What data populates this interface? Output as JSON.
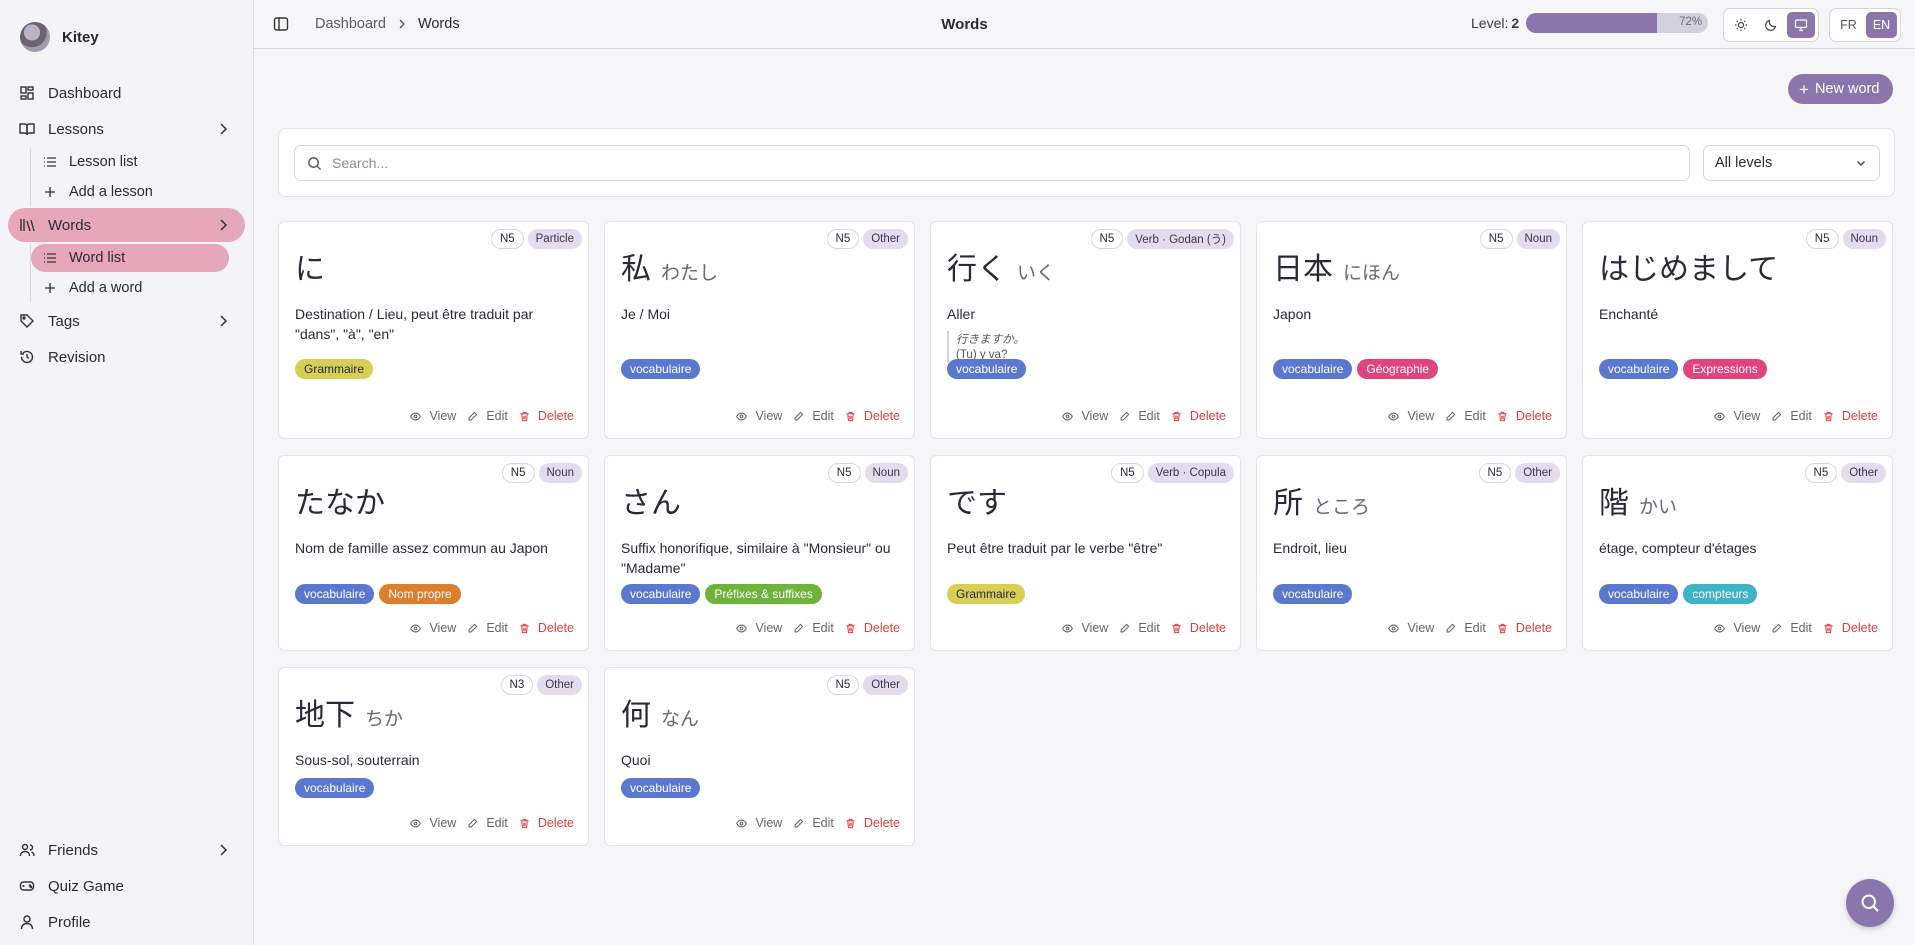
{
  "user": {
    "name": "Kitey"
  },
  "sidebar": {
    "dashboard": "Dashboard",
    "lessons": "Lessons",
    "lesson_list": "Lesson list",
    "add_lesson": "Add a lesson",
    "words": "Words",
    "word_list": "Word list",
    "add_word": "Add a word",
    "tags": "Tags",
    "revision": "Revision",
    "friends": "Friends",
    "quiz_game": "Quiz Game",
    "profile": "Profile"
  },
  "header": {
    "breadcrumb_root": "Dashboard",
    "breadcrumb_current": "Words",
    "title": "Words",
    "level_label": "Level:",
    "level_value": "2",
    "progress_text": "72%",
    "progress_value": 72,
    "lang_fr": "FR",
    "lang_en": "EN"
  },
  "toolbar": {
    "new_word": "New word",
    "search_placeholder": "Search...",
    "level_filter": "All levels"
  },
  "actions": {
    "view": "View",
    "edit": "Edit",
    "delete": "Delete"
  },
  "colors": {
    "accent": "#8a76ad",
    "active_nav": "#e5a7b9",
    "tag_vocabulaire": "#5b78cf",
    "tag_grammaire": "#d7cf55",
    "tag_geographie": "#e0447e",
    "tag_expressions": "#e0447e",
    "tag_nom_propre": "#dc7e2c",
    "tag_prefixes": "#6fb33a",
    "tag_compteurs": "#3fb3c6",
    "delete": "#e23c3c"
  },
  "cards": [
    {
      "kanji": "に",
      "reading": "",
      "level": "N5",
      "type": "Particle",
      "meaning": "Destination / Lieu, peut être traduit par \"dans\", \"à\", \"en\"",
      "example_jp": "",
      "example_fr": "",
      "tags": [
        {
          "label": "Grammaire",
          "color": "#d7cf55",
          "text": "#2a2a35"
        }
      ]
    },
    {
      "kanji": "私",
      "reading": "わたし",
      "level": "N5",
      "type": "Other",
      "meaning": "Je / Moi",
      "example_jp": "",
      "example_fr": "",
      "tags": [
        {
          "label": "vocabulaire",
          "color": "#5b78cf",
          "text": "#ffffff"
        }
      ]
    },
    {
      "kanji": "行く",
      "reading": "いく",
      "level": "N5",
      "type": "Verb · Godan (う)",
      "meaning": "Aller",
      "example_jp": "行きますか。",
      "example_fr": "(Tu) y va?",
      "tags": [
        {
          "label": "vocabulaire",
          "color": "#5b78cf",
          "text": "#ffffff"
        }
      ]
    },
    {
      "kanji": "日本",
      "reading": "にほん",
      "level": "N5",
      "type": "Noun",
      "meaning": "Japon",
      "example_jp": "",
      "example_fr": "",
      "tags": [
        {
          "label": "vocabulaire",
          "color": "#5b78cf",
          "text": "#ffffff"
        },
        {
          "label": "Géographie",
          "color": "#e0447e",
          "text": "#ffffff"
        }
      ]
    },
    {
      "kanji": "はじめまして",
      "reading": "",
      "level": "N5",
      "type": "Noun",
      "meaning": "Enchanté",
      "example_jp": "",
      "example_fr": "",
      "tags": [
        {
          "label": "vocabulaire",
          "color": "#5b78cf",
          "text": "#ffffff"
        },
        {
          "label": "Expressions",
          "color": "#e0447e",
          "text": "#ffffff"
        }
      ]
    },
    {
      "kanji": "たなか",
      "reading": "",
      "level": "N5",
      "type": "Noun",
      "meaning": "Nom de famille assez commun au Japon",
      "example_jp": "",
      "example_fr": "",
      "tags": [
        {
          "label": "vocabulaire",
          "color": "#5b78cf",
          "text": "#ffffff"
        },
        {
          "label": "Nom propre",
          "color": "#dc7e2c",
          "text": "#ffffff"
        }
      ]
    },
    {
      "kanji": "さん",
      "reading": "",
      "level": "N5",
      "type": "Noun",
      "meaning": "Suffix honorifique, similaire à \"Monsieur\" ou \"Madame\"",
      "example_jp": "",
      "example_fr": "",
      "tags": [
        {
          "label": "vocabulaire",
          "color": "#5b78cf",
          "text": "#ffffff"
        },
        {
          "label": "Préfixes & suffixes",
          "color": "#6fb33a",
          "text": "#ffffff"
        }
      ]
    },
    {
      "kanji": "です",
      "reading": "",
      "level": "N5",
      "type": "Verb · Copula",
      "meaning": "Peut être traduit par le verbe \"être\"",
      "example_jp": "",
      "example_fr": "",
      "tags": [
        {
          "label": "Grammaire",
          "color": "#d7cf55",
          "text": "#2a2a35"
        }
      ]
    },
    {
      "kanji": "所",
      "reading": "ところ",
      "level": "N5",
      "type": "Other",
      "meaning": "Endroit, lieu",
      "example_jp": "",
      "example_fr": "",
      "tags": [
        {
          "label": "vocabulaire",
          "color": "#5b78cf",
          "text": "#ffffff"
        }
      ]
    },
    {
      "kanji": "階",
      "reading": "かい",
      "level": "N5",
      "type": "Other",
      "meaning": "étage, compteur d'étages",
      "example_jp": "",
      "example_fr": "",
      "tags": [
        {
          "label": "vocabulaire",
          "color": "#5b78cf",
          "text": "#ffffff"
        },
        {
          "label": "compteurs",
          "color": "#3fb3c6",
          "text": "#ffffff"
        }
      ]
    },
    {
      "kanji": "地下",
      "reading": "ちか",
      "level": "N3",
      "type": "Other",
      "meaning": "Sous-sol, souterrain",
      "example_jp": "",
      "example_fr": "",
      "tags": [
        {
          "label": "vocabulaire",
          "color": "#5b78cf",
          "text": "#ffffff"
        }
      ]
    },
    {
      "kanji": "何",
      "reading": "なん",
      "level": "N5",
      "type": "Other",
      "meaning": "Quoi",
      "example_jp": "",
      "example_fr": "",
      "tags": [
        {
          "label": "vocabulaire",
          "color": "#5b78cf",
          "text": "#ffffff"
        }
      ]
    }
  ]
}
